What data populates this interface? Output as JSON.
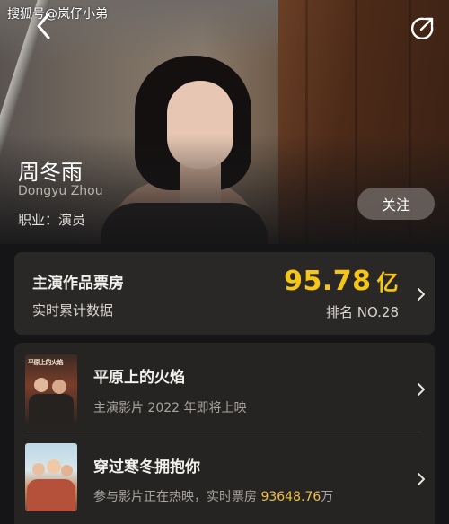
{
  "watermark": "搜狐号@岚仔小弟",
  "actor": {
    "name": "周冬雨",
    "name_en": "Dongyu Zhou",
    "occupation": "职业：演员",
    "follow_label": "关注"
  },
  "box_office": {
    "title": "主演作品票房",
    "subtitle": "实时累计数据",
    "value": "95.78",
    "unit": "亿",
    "rank": "排名 NO.28",
    "accent_color": "#f5c518"
  },
  "works": [
    {
      "title": "平原上的火焰",
      "desc": "主演影片 2022 年即将上映",
      "poster_text": "平原上的火焰"
    },
    {
      "title": "穿过寒冬拥抱你",
      "desc_prefix": "参与影片正在热映，实时票房 ",
      "desc_value": "93648.76",
      "desc_suffix": "万"
    }
  ],
  "icons": {
    "back": "chevron-left-icon",
    "share": "share-icon",
    "chevron": "chevron-right-icon"
  }
}
